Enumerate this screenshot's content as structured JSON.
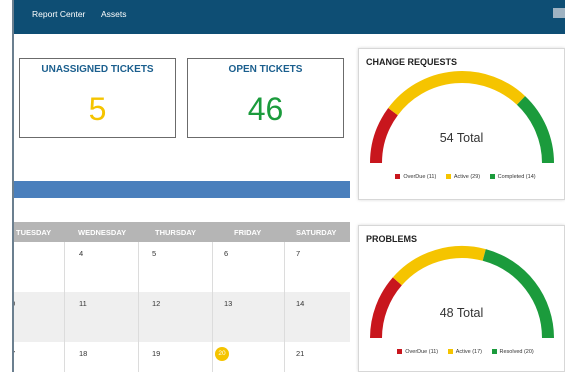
{
  "nav": {
    "items": [
      "Report Center",
      "Assets"
    ]
  },
  "cards": {
    "unassigned": {
      "title": "UNASSIGNED TICKETS",
      "value": "5"
    },
    "open": {
      "title": "OPEN TICKETS",
      "value": "46"
    }
  },
  "calendar": {
    "days": [
      "TUESDAY",
      "WEDNESDAY",
      "THURSDAY",
      "FRIDAY",
      "SATURDAY"
    ],
    "rows": [
      [
        "",
        "4",
        "5",
        "6",
        "7"
      ],
      [
        "0",
        "11",
        "12",
        "13",
        "14"
      ],
      [
        "7",
        "18",
        "19",
        "20",
        "21"
      ]
    ],
    "today": "20"
  },
  "change_requests": {
    "title": "CHANGE REQUESTS",
    "total_label": "54 Total",
    "total": 54,
    "segments": [
      {
        "name": "OverDue",
        "count": 11,
        "label": "OverDue (11)",
        "color": "#c8161d"
      },
      {
        "name": "Active",
        "count": 29,
        "label": "Active (29)",
        "color": "#f5c400"
      },
      {
        "name": "Completed",
        "count": 14,
        "label": "Completed (14)",
        "color": "#1b9b3c"
      }
    ]
  },
  "problems": {
    "title": "PROBLEMS",
    "total_label": "48 Total",
    "total": 48,
    "segments": [
      {
        "name": "OverDue",
        "count": 11,
        "label": "OverDue (11)",
        "color": "#c8161d"
      },
      {
        "name": "Active",
        "count": 17,
        "label": "Active (17)",
        "color": "#f5c400"
      },
      {
        "name": "Resolved",
        "count": 20,
        "label": "Resolved (20)",
        "color": "#1b9b3c"
      }
    ]
  },
  "colors": {
    "topbar": "#0e4e74",
    "card_title": "#1b5f8e",
    "bluebar": "#4a7fbc"
  }
}
